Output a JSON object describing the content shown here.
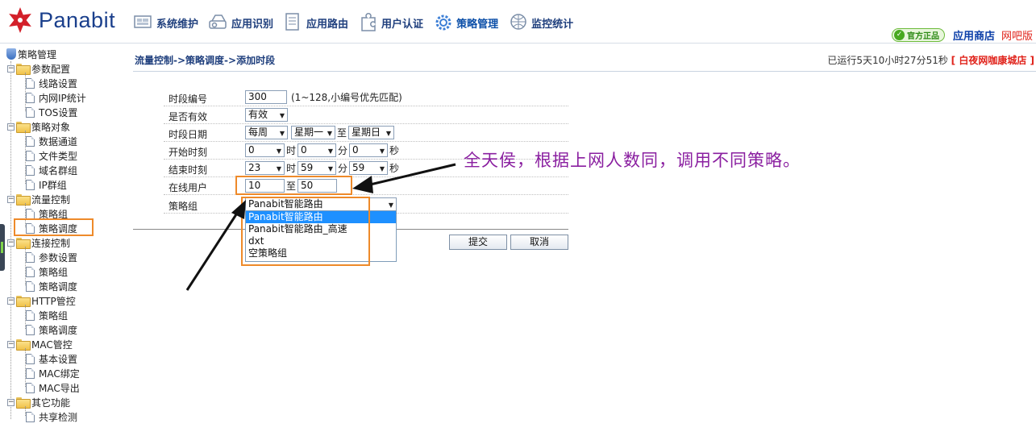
{
  "header": {
    "brand": "Panabit",
    "nav": [
      {
        "label": "系统维护",
        "icon": "system-maintenance-icon"
      },
      {
        "label": "应用识别",
        "icon": "app-recognition-icon"
      },
      {
        "label": "应用路由",
        "icon": "app-routing-icon"
      },
      {
        "label": "用户认证",
        "icon": "user-auth-icon"
      },
      {
        "label": "策略管理",
        "icon": "policy-management-icon",
        "active": true
      },
      {
        "label": "监控统计",
        "icon": "monitoring-icon"
      }
    ],
    "official_badge": "官方正品",
    "app_store": "应用商店",
    "netbar": "网吧版"
  },
  "sidebar": {
    "root": "策略管理",
    "groups": [
      {
        "label": "参数配置",
        "items": [
          "线路设置",
          "内网IP统计",
          "TOS设置"
        ]
      },
      {
        "label": "策略对象",
        "items": [
          "数据通道",
          "文件类型",
          "域名群组",
          "IP群组"
        ]
      },
      {
        "label": "流量控制",
        "items": [
          "策略组",
          "策略调度"
        ]
      },
      {
        "label": "连接控制",
        "items": [
          "参数设置",
          "策略组",
          "策略调度"
        ]
      },
      {
        "label": "HTTP管控",
        "items": [
          "策略组",
          "策略调度"
        ]
      },
      {
        "label": "MAC管控",
        "items": [
          "基本设置",
          "MAC绑定",
          "MAC导出"
        ]
      },
      {
        "label": "其它功能",
        "items": [
          "共享检测"
        ]
      }
    ]
  },
  "main": {
    "breadcrumb": "流量控制->策略调度->添加时段",
    "uptime_prefix": "已运行5天10小时27分51秒",
    "shop_name": "[ 白夜网咖康城店 ]",
    "form": {
      "period_id": {
        "label": "时段编号",
        "value": "300",
        "hint": "(1~128,小编号优先匹配)"
      },
      "enabled": {
        "label": "是否有效",
        "value": "有效"
      },
      "date": {
        "label": "时段日期",
        "freq": "每周",
        "from": "星期一",
        "to_sep": "至",
        "to": "星期日"
      },
      "start": {
        "label": "开始时刻",
        "hour": "0",
        "hour_unit": "时",
        "min": "0",
        "min_unit": "分",
        "sec": "0",
        "sec_unit": "秒"
      },
      "end": {
        "label": "结束时刻",
        "hour": "23",
        "hour_unit": "时",
        "min": "59",
        "min_unit": "分",
        "sec": "59",
        "sec_unit": "秒"
      },
      "online_users": {
        "label": "在线用户",
        "from": "10",
        "to_sep": "至",
        "to": "50"
      },
      "policy_group": {
        "label": "策略组",
        "value": "Panabit智能路由"
      }
    },
    "dropdown_options": [
      "Panabit智能路由",
      "Panabit智能路由_高速",
      "dxt",
      "空策略组"
    ],
    "submit_label": "提交",
    "cancel_label": "取消"
  },
  "annotation": "全天侯，根据上网人数同，调用不同策略。",
  "colors": {
    "highlight": "#ee8a2a",
    "annotation": "#8a1fa0",
    "selected_option": "#1e90ff",
    "brand_blue": "#1a3f8c"
  }
}
